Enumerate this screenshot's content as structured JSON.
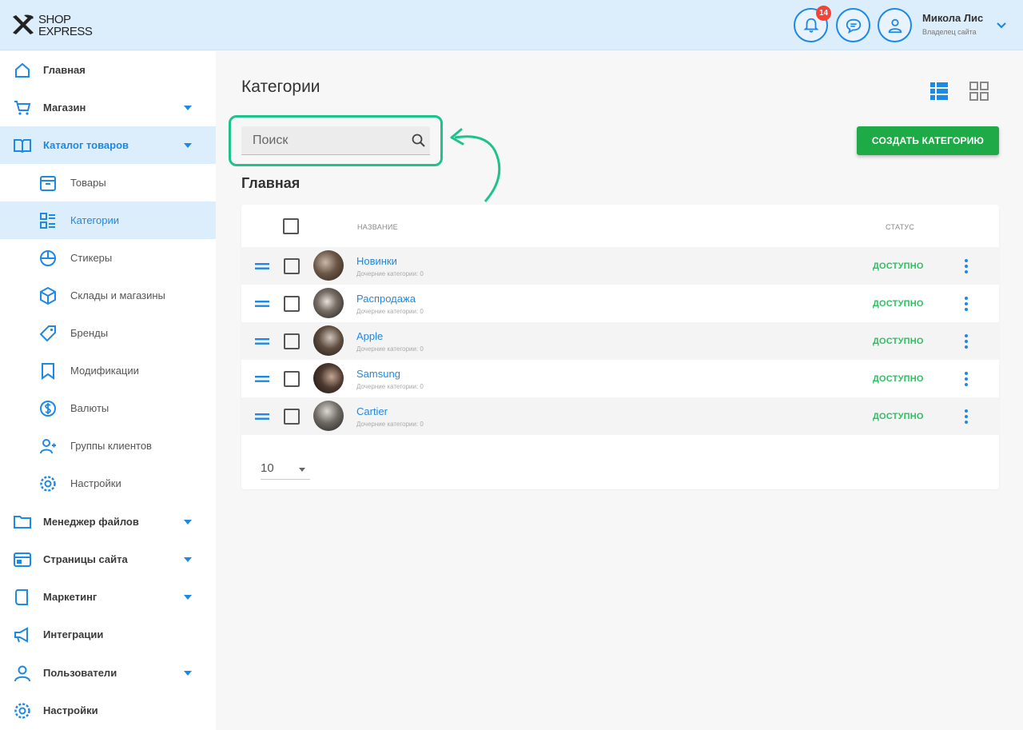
{
  "header": {
    "logo_line1": "SHOP",
    "logo_line2": "EXPRESS",
    "notifications_count": "14",
    "user_name": "Микола Лис",
    "user_role": "Владелец сайта"
  },
  "sidebar": {
    "items": [
      {
        "label": "Главная",
        "icon": "home-icon"
      },
      {
        "label": "Магазин",
        "icon": "cart-icon",
        "has_caret": true
      },
      {
        "label": "Каталог товаров",
        "icon": "catalog-book-icon",
        "has_caret": true,
        "active": true
      },
      {
        "label": "Товары",
        "icon": "box-icon",
        "sub": true
      },
      {
        "label": "Категории",
        "icon": "categories-list-icon",
        "sub": true,
        "active": true
      },
      {
        "label": "Стикеры",
        "icon": "sticker-icon",
        "sub": true
      },
      {
        "label": "Склады и магазины",
        "icon": "warehouse-cube-icon",
        "sub": true
      },
      {
        "label": "Бренды",
        "icon": "tag-icon",
        "sub": true
      },
      {
        "label": "Модификации",
        "icon": "bookmark-icon",
        "sub": true
      },
      {
        "label": "Валюты",
        "icon": "dollar-icon",
        "sub": true
      },
      {
        "label": "Группы клиентов",
        "icon": "users-group-icon",
        "sub": true
      },
      {
        "label": "Настройки",
        "icon": "gear-icon",
        "sub": true
      },
      {
        "label": "Менеджер файлов",
        "icon": "folder-icon",
        "has_caret": true
      },
      {
        "label": "Страницы сайта",
        "icon": "browser-page-icon",
        "has_caret": true
      },
      {
        "label": "Маркетинг",
        "icon": "marketing-icon",
        "has_caret": true
      },
      {
        "label": "Интеграции",
        "icon": "megaphone-icon"
      },
      {
        "label": "Пользователи",
        "icon": "user-icon",
        "has_caret": true
      },
      {
        "label": "Настройки",
        "icon": "settings-gear-icon"
      }
    ]
  },
  "main": {
    "title": "Категории",
    "search_placeholder": "Поиск",
    "create_button": "СОЗДАТЬ КАТЕГОРИЮ",
    "section_title": "Главная",
    "table": {
      "col_name": "НАЗВАНИЕ",
      "col_status": "СТАТУС",
      "rows": [
        {
          "name": "Новинки",
          "sub": "Дочерние категории: 0",
          "status": "ДОСТУПНО"
        },
        {
          "name": "Распродажа",
          "sub": "Дочерние категории: 0",
          "status": "ДОСТУПНО"
        },
        {
          "name": "Apple",
          "sub": "Дочерние категории: 0",
          "status": "ДОСТУПНО"
        },
        {
          "name": "Samsung",
          "sub": "Дочерние категории: 0",
          "status": "ДОСТУПНО"
        },
        {
          "name": "Cartier",
          "sub": "Дочерние категории: 0",
          "status": "ДОСТУПНО"
        }
      ]
    },
    "per_page": "10"
  },
  "colors": {
    "accent": "#1e88e5",
    "header_bg": "#dcedfb",
    "create_button": "#1faa48",
    "status_available": "#2ebf62",
    "highlight": "#1ec28b",
    "badge": "#f44336"
  }
}
